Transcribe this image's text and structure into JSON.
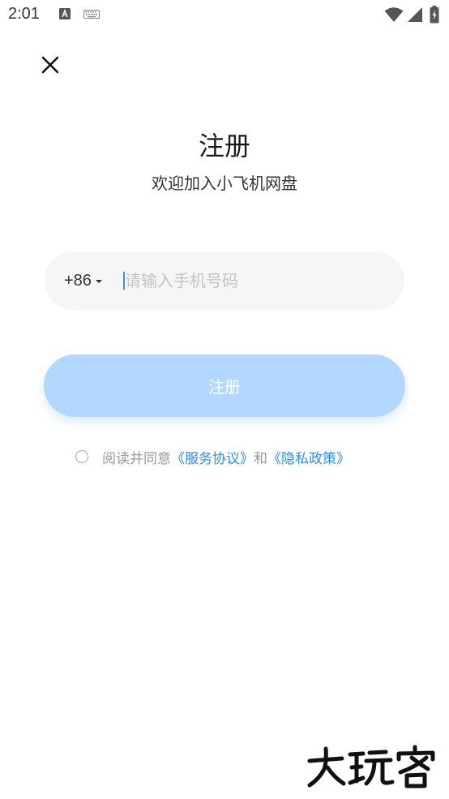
{
  "status_bar": {
    "time": "2:01"
  },
  "header": {
    "title": "注册",
    "subtitle": "欢迎加入小飞机网盘"
  },
  "phone_field": {
    "country_code": "+86",
    "placeholder": "请输入手机号码",
    "value": ""
  },
  "register_button": {
    "label": "注册",
    "color": "#b3d8ff"
  },
  "agreement": {
    "prefix": "阅读并同意",
    "terms_link": "《服务协议》",
    "connector": "和",
    "privacy_link": "《隐私政策》",
    "checked": false,
    "link_color": "#2f8cf0"
  },
  "watermark": {
    "text": "大玩客"
  },
  "icons": {
    "close": "close-icon",
    "dropdown": "dropdown-arrow-icon",
    "wifi": "wifi-icon",
    "signal": "signal-icon",
    "battery": "battery-icon"
  }
}
